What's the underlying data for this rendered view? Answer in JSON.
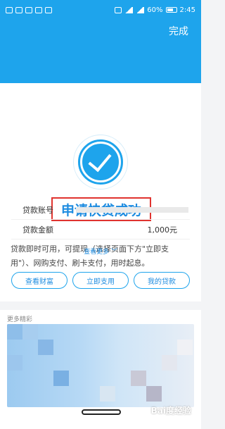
{
  "status": {
    "left_icons": [
      "sim-icon",
      "signal-icon",
      "wechat-icon",
      "alarm-icon",
      "settings-icon"
    ],
    "right_icons": [
      "vibrate-icon",
      "wifi-icon",
      "signal-bars-icon"
    ],
    "battery": "60%",
    "time": "2:45"
  },
  "header": {
    "done_label": "完成"
  },
  "card": {
    "title": "申请快贷成功",
    "description": "贷款即时可用，可提现（选择页面下方\"立即支用\"）、网购支付、刷卡支付，用时起息。",
    "rows": [
      {
        "label": "贷款账号",
        "value": ""
      },
      {
        "label": "贷款金额",
        "value": "1,000元"
      }
    ],
    "see_more": "查看更多 ﹀"
  },
  "buttons": {
    "wealth": "查看财富",
    "use_now": "立即支用",
    "my_loan": "我的贷款"
  },
  "more": {
    "title": "更多精彩"
  },
  "colors": {
    "brand": "#1ea4ec",
    "title_border": "#e0332f",
    "link": "#1e8ce0"
  },
  "watermark": "Bai度经验"
}
